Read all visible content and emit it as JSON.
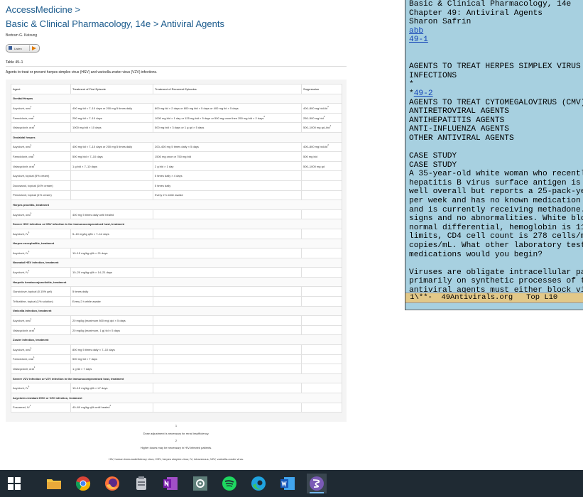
{
  "page": {
    "brand": "AccessMedicine >",
    "title": "Basic & Clinical Pharmacology, 14e > Antiviral Agents",
    "author": "Bertram G. Katzung",
    "listen_label": "Listen",
    "table_label": "Table 49–1",
    "caption": "Agents to treat or prevent herpes simplex virus (HSV) and varicella-zoster virus (VZV) infections.",
    "columns": [
      "Agent",
      "Treatment of First Episode",
      "Treatment of Recurrent Episodes",
      "Suppression"
    ],
    "rows": [
      {
        "section": "Genital Herpes"
      },
      {
        "c": [
          "Acyclovir, oral",
          "400 mg tid × 7–10 days or 200 mg 5 times daily",
          "800 mg tid × 2 days or 800 mg bid × 5 days or 400 mg tid × 5 days",
          "400–800 mg bid-tid"
        ],
        "sup0": "1",
        "sup3": "2"
      },
      {
        "c": [
          "Famciclovir, oral",
          "250 mg tid × 7–10 days",
          "1000 mg bid × 1 day or 125 mg bid × 5 days or 500 mg once then 250 mg bid × 2 days",
          "250–500 mg bid"
        ],
        "sup0": "1",
        "sup2": "2",
        "sup3": "2"
      },
      {
        "c": [
          "Valacyclovir, oral",
          "1000 mg bid × 10 days",
          "500 mg bid × 3 days or 1 g qd × 5 days",
          "500–1000 mg qd–bid"
        ],
        "sup0": "1",
        "sup3": "2"
      },
      {
        "section": "Orolabial herpes"
      },
      {
        "c": [
          "Acyclovir, oral",
          "400 mg tid × 7–10 days or 200 mg 5 times daily",
          "200–400 mg 5 times daily × 5 days",
          "400–800 mg bid-tid"
        ],
        "sup0": "1",
        "sup3": "2"
      },
      {
        "c": [
          "Famciclovir, oral",
          "500 mg bid × 7–10 days",
          "1500 mg once or 750 mg bid",
          "500 mg bid"
        ],
        "sup0": "1"
      },
      {
        "c": [
          "Valacyclovir, oral",
          "1 g bid × 7–10 days",
          "2 g bid × 1 day",
          "500–1000 mg qd"
        ],
        "sup0": "1"
      },
      {
        "c": [
          "Acyclovir, topical (5% cream)",
          "",
          "5 times daily × 4 days",
          ""
        ]
      },
      {
        "c": [
          "Docosanol, topical (10% cream)",
          "",
          "5 times daily",
          ""
        ]
      },
      {
        "c": [
          "Penciclovir, topical (1% cream)",
          "",
          "Every 2 h while awake",
          ""
        ]
      },
      {
        "section": "Herpes proctitis, treatment"
      },
      {
        "c": [
          "Acyclovir, oral",
          "400 mg 5 times daily until healed"
        ],
        "sup0": "1"
      },
      {
        "section": "Severe HSV infection or HSV infection in the immunocompromised host, treatment"
      },
      {
        "c": [
          "Acyclovir, IV",
          "5–10 mg/kg q8h × 7–14 days"
        ],
        "sup0": "1"
      },
      {
        "section": "Herpes encephalitis, treatment"
      },
      {
        "c": [
          "Acyclovir, IV",
          "10–15 mg/kg q8h × 21 days"
        ],
        "sup0": "1"
      },
      {
        "section": "Neonatal HSV infection, treatment"
      },
      {
        "c": [
          "Acyclovir, IV",
          "10–20 mg/kg q8h × 14–21 days"
        ],
        "sup0": "1"
      },
      {
        "section": "Herpetic keratoconjunctivitis, treatment"
      },
      {
        "c": [
          "Ganciclovir, topical (0.15% gel)",
          "5 times daily"
        ]
      },
      {
        "c": [
          "Trifluridine, topical (1% solution)",
          "Every 2 h while awake"
        ]
      },
      {
        "section": "Varicella infection, treatment"
      },
      {
        "c": [
          "Acyclovir, oral",
          "20 mg/kg (maximum 800 mg) qid × 5 days"
        ],
        "sup0": "1"
      },
      {
        "c": [
          "Valacyclovir, oral",
          "20 mg/kg (maximum, 1 g) tid × 5 days"
        ],
        "sup0": "1"
      },
      {
        "section": "Zoster infection, treatment"
      },
      {
        "c": [
          "Acyclovir, oral",
          "800 mg 5 times daily × 7–10 days"
        ],
        "sup0": "1"
      },
      {
        "c": [
          "Famciclovir, oral",
          "500 mg tid × 7 days"
        ],
        "sup0": "1"
      },
      {
        "c": [
          "Valacyclovir, oral",
          "1 g tid × 7 days"
        ],
        "sup0": "1"
      },
      {
        "section": "Severe VZV infection or VZV infection in the immunocompromised host, treatment"
      },
      {
        "c": [
          "Acyclovir, IV",
          "10–15 mg/kg q8h × ≥7 days"
        ],
        "sup0": "1"
      },
      {
        "section": "Acyclovir-resistant HSV or VZV infection, treatment"
      },
      {
        "c": [
          "Foscarnet, IV",
          "40–60 mg/kg q8h until healed"
        ],
        "sup0": "1",
        "sup1": "2"
      }
    ],
    "footnotes": [
      {
        "mark": "1",
        "text": "Dose adjustment is necessary for renal insufficiency."
      },
      {
        "mark": "2",
        "text": "Higher doses may be necessary in HIV-infected patients."
      }
    ],
    "abbrev": "HIV, human immunodeficiency virus; HSV, herpes simplex virus; IV, intravenous; VZV, varicella-zoster virus."
  },
  "terminal": {
    "lines": [
      {
        "t": "Basic & Clinical Pharmacology, 14e"
      },
      {
        "t": "Chapter 49: Antiviral Agents"
      },
      {
        "t": "Sharon Safrin"
      },
      {
        "t": "abb",
        "link": true
      },
      {
        "t": "49-1",
        "link": true
      },
      {
        "t": ""
      },
      {
        "t": ""
      },
      {
        "t": "AGENTS TO TREAT HERPES SIMPLEX VIRUS"
      },
      {
        "t": "INFECTIONS"
      },
      {
        "t": "*"
      },
      {
        "t": "*",
        "link_tail": "49-2"
      },
      {
        "t": "AGENTS TO TREAT CYTOMEGALOVIRUS (CMV)"
      },
      {
        "t": "ANTIRETROVIRAL AGENTS"
      },
      {
        "t": "ANTIHEPATITIS AGENTS"
      },
      {
        "t": "ANTI-INFLUENZA AGENTS"
      },
      {
        "t": "OTHER ANTIVIRAL AGENTS"
      },
      {
        "t": ""
      },
      {
        "t": "CASE STUDY"
      },
      {
        "t": "CASE STUDY"
      },
      {
        "t": "A 35-year-old white woman who recentl"
      },
      {
        "t": "hepatitis B virus surface antigen is"
      },
      {
        "t": "well overall but reports a 25-pack-ye"
      },
      {
        "t": "per week and has no known medication"
      },
      {
        "t": "and is currently receiving methadone."
      },
      {
        "t": "signs and no abnormalities. White blo"
      },
      {
        "t": "normal differential, hemoglobin is 11"
      },
      {
        "t": "limits, CD4 cell count is 278 cells/m"
      },
      {
        "t": "copies/mL. What other laboratory test"
      },
      {
        "t": "medications would you begin?"
      },
      {
        "t": ""
      },
      {
        "t": "Viruses are obligate intracellular pa"
      },
      {
        "t": "primarily on synthetic processes of t"
      },
      {
        "t": "antiviral agents must either block vi"
      }
    ],
    "modeline": " 1\\**-  49Antivirals.org   Top L10"
  },
  "taskbar": {
    "background": "#1f2a33",
    "items": [
      {
        "name": "windows-start-icon"
      },
      {
        "name": "file-explorer-icon"
      },
      {
        "name": "chrome-icon"
      },
      {
        "name": "firefox-icon"
      },
      {
        "name": "app-icon"
      },
      {
        "name": "onenote-icon"
      },
      {
        "name": "settings-icon"
      },
      {
        "name": "spotify-icon"
      },
      {
        "name": "edge-icon"
      },
      {
        "name": "word-icon"
      },
      {
        "name": "emacs-icon"
      }
    ]
  }
}
